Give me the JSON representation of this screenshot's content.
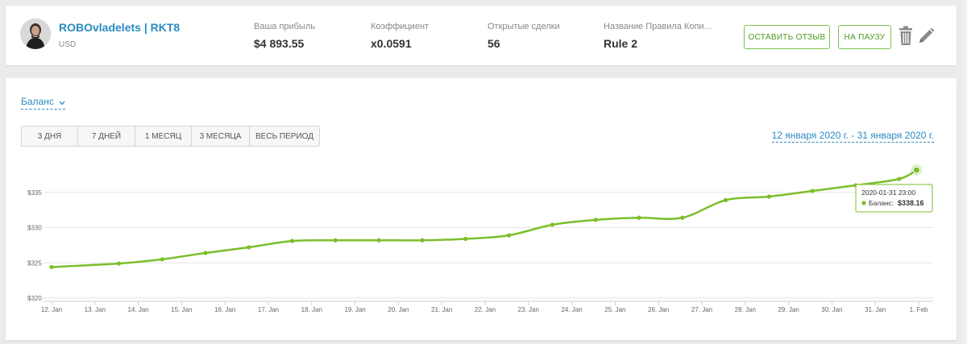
{
  "header": {
    "account_name": "ROBOvladelets | RKT8",
    "currency": "USD",
    "stats": [
      {
        "label": "Ваша прибыль",
        "value": "$4 893.55"
      },
      {
        "label": "Коэффициент",
        "value": "x0.0591"
      },
      {
        "label": "Открытые сделки",
        "value": "56"
      },
      {
        "label": "Название Правила Копи...",
        "value": "Rule 2"
      }
    ],
    "review_button": "ОСТАВИТЬ ОТЗЫВ",
    "pause_button": "НА ПАУЗУ",
    "icons": {
      "delete": "trash-icon",
      "edit": "pencil-icon"
    }
  },
  "chart_panel": {
    "metric_select": "Баланс",
    "periods": [
      "3 ДНЯ",
      "7 ДНЕЙ",
      "1 МЕСЯЦ",
      "3 МЕСЯЦА",
      "ВЕСЬ ПЕРИОД"
    ],
    "date_range": "12 января 2020 г. - 31 января 2020 г."
  },
  "tooltip": {
    "date": "2020-01-31 23:00",
    "series_label": "Баланс:",
    "value": "$338.16"
  },
  "colors": {
    "accent_blue": "#2a8bc2",
    "line_green": "#7bbf2a",
    "button_green": "#4a9a1c"
  },
  "chart_data": {
    "type": "line",
    "x_ticks": [
      "12. Jan",
      "13. Jan",
      "14. Jan",
      "15. Jan",
      "16. Jan",
      "17. Jan",
      "18. Jan",
      "19. Jan",
      "20. Jan",
      "21. Jan",
      "22. Jan",
      "23. Jan",
      "24. Jan",
      "25. Jan",
      "26. Jan",
      "27. Jan",
      "28. Jan",
      "29. Jan",
      "30. Jan",
      "31. Jan",
      "1. Feb"
    ],
    "y_ticks": [
      "$320",
      "$325",
      "$330",
      "$335"
    ],
    "ylim": [
      320,
      339
    ],
    "grid": true,
    "series": [
      {
        "points": [
          {
            "day": 0.0,
            "value": 324.4
          },
          {
            "day": 1.55,
            "value": 324.9
          },
          {
            "day": 2.55,
            "value": 325.5
          },
          {
            "day": 3.55,
            "value": 326.4
          },
          {
            "day": 4.55,
            "value": 327.2
          },
          {
            "day": 5.55,
            "value": 328.1
          },
          {
            "day": 6.55,
            "value": 328.2
          },
          {
            "day": 7.55,
            "value": 328.2
          },
          {
            "day": 8.55,
            "value": 328.2
          },
          {
            "day": 9.55,
            "value": 328.4
          },
          {
            "day": 10.55,
            "value": 328.9
          },
          {
            "day": 11.55,
            "value": 330.4
          },
          {
            "day": 12.55,
            "value": 331.1
          },
          {
            "day": 13.55,
            "value": 331.4
          },
          {
            "day": 14.55,
            "value": 331.4
          },
          {
            "day": 15.55,
            "value": 333.9
          },
          {
            "day": 16.55,
            "value": 334.4
          },
          {
            "day": 17.55,
            "value": 335.2
          },
          {
            "day": 18.55,
            "value": 336.0
          },
          {
            "day": 19.55,
            "value": 336.9
          },
          {
            "day": 19.95,
            "value": 338.16
          }
        ]
      }
    ]
  }
}
